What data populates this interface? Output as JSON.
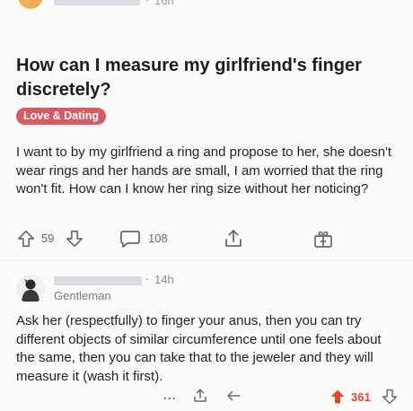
{
  "top": {
    "time": "16h",
    "dot": "·"
  },
  "post": {
    "title": "How can I measure my girlfriend's finger discretely?",
    "flair": "Love & Dating",
    "body": "I want to by my girlfriend a ring and propose to her, she doesn't wear rings and her hands are small, I am worried that the ring won't fit. How can I know her ring size without her noticing?",
    "score": "59",
    "comments": "108"
  },
  "comment": {
    "dot": "·",
    "time": "14h",
    "user_flair": "Gentleman",
    "body": "Ask her (respectfully) to finger your anus, then you can try different objects of similar circumference until one feels about the same, then you can take that to the jeweler and they will measure it (wash it first).",
    "more": "...",
    "score": "361"
  },
  "colors": {
    "flair_bg": "#d95a63",
    "upvoted": "#d94a2a",
    "icon": "#6b6b6b"
  },
  "icons": {
    "upvote": "arrow-up-outline-icon",
    "downvote": "arrow-down-outline-icon",
    "comment": "speech-bubble-icon",
    "share": "share-icon",
    "award": "gift-icon",
    "reply": "reply-arrow-icon",
    "upvoted": "arrow-up-filled-icon"
  }
}
